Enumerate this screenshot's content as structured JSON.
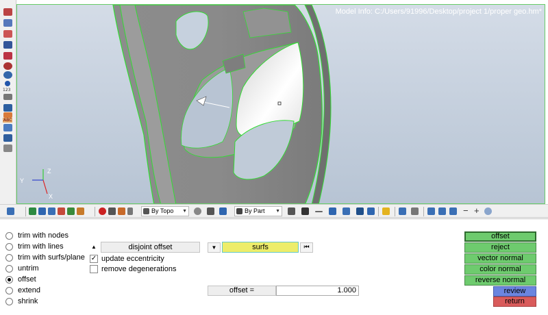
{
  "viewport": {
    "model_info": "Model Info: C:/Users/91996/Desktop/project 1/proper geo.hm*",
    "triad": {
      "x_label": "X",
      "y_label": "Y",
      "z_label": "Z"
    },
    "background_color": "#c3cedb",
    "edge_color": "#33dd33"
  },
  "left_toolbar": {
    "icons": [
      "edges-icon",
      "edge-color-icon",
      "faces-icon",
      "surface-icon",
      "solid-icon",
      "mask-icon",
      "color-icon",
      "info-icon",
      "numbers-icon",
      "measure-icon",
      "mesh-icon",
      "abc-icon",
      "abc-label-icon",
      "table-icon",
      "cube-icon",
      "weight-icon"
    ],
    "label_123": "123",
    "label_abc": "ABC"
  },
  "h_toolbar": {
    "topo_dropdown": "By Topo",
    "part_dropdown": "By Part"
  },
  "panel": {
    "radio_options": [
      {
        "label": "trim with nodes",
        "selected": false
      },
      {
        "label": "trim with lines",
        "selected": false
      },
      {
        "label": "trim with surfs/plane",
        "selected": false
      },
      {
        "label": "untrim",
        "selected": false
      },
      {
        "label": "offset",
        "selected": true
      },
      {
        "label": "extend",
        "selected": false
      },
      {
        "label": "shrink",
        "selected": false
      }
    ],
    "mode_button": "disjoint offset",
    "update_eccentricity": {
      "label": "update eccentricity",
      "checked": true
    },
    "remove_degenerations": {
      "label": "remove degenerations",
      "checked": false
    },
    "selector_label": "surfs",
    "offset_label": "offset =",
    "offset_value": "1.000",
    "actions": {
      "offset": "offset",
      "reject": "reject",
      "vector_normal": "vector normal",
      "color_normal": "color normal",
      "reverse_normal": "reverse normal",
      "review": "review",
      "return": "return"
    }
  },
  "colors": {
    "action_green": "#6ecb6e",
    "review_blue": "#6b85df",
    "return_red": "#d95b5b",
    "selector_yellow": "#eded6a"
  }
}
